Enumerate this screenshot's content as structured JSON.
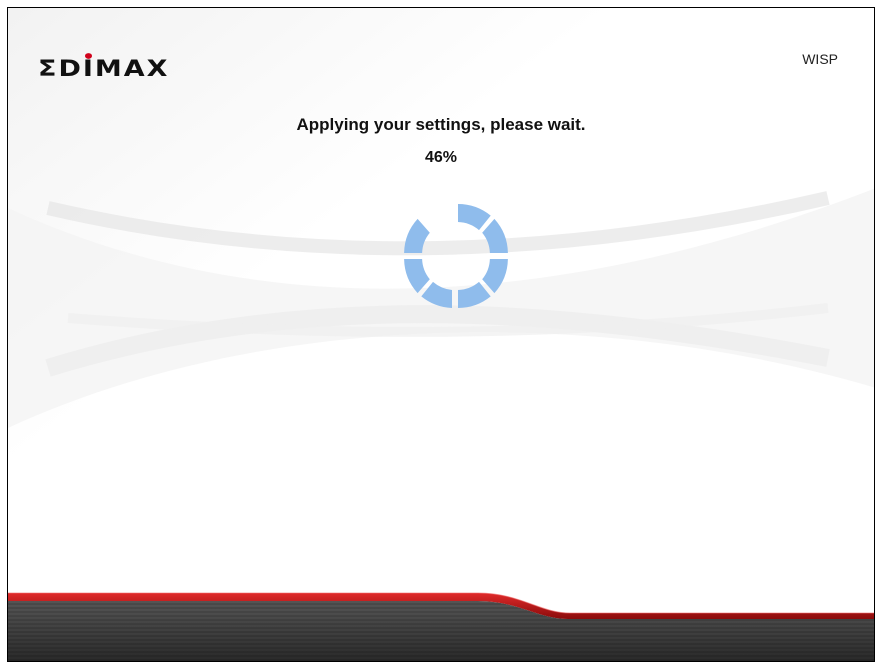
{
  "header": {
    "brand_logo": "EDIMAX",
    "mode_label": "WISP"
  },
  "main": {
    "status_message": "Applying your settings, please wait.",
    "progress_percent": 46,
    "progress_text": "46%"
  },
  "colors": {
    "spinner_segment": "#8fbcec",
    "logo_dot": "#d0021b",
    "footer_red": "#c0121b",
    "footer_dark": "#3a3a3a"
  },
  "icons": {
    "spinner": "loading-spinner-icon"
  }
}
